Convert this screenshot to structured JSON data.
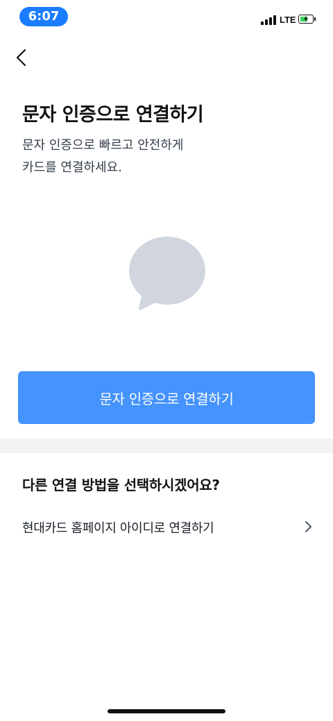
{
  "status_bar": {
    "time": "6:07",
    "network": "LTE"
  },
  "header": {
    "title": "문자 인증으로 연결하기",
    "description_lines": [
      "문자 인증으로 빠르고 안전하게",
      "카드를 연결하세요."
    ]
  },
  "illustration": {
    "icon": "chat-bubble-icon",
    "color": "#d1d6de"
  },
  "primary_action": {
    "label": "문자 인증으로 연결하기",
    "color": "#4593fc"
  },
  "alternatives": {
    "title": "다른 연결 방법을 선택하시겠어요?",
    "options": [
      {
        "label": "현대카드 홈페이지 아이디로 연결하기",
        "icon": "chevron-right-icon"
      }
    ]
  },
  "colors": {
    "time_pill": "#1a7cff",
    "battery_fill": "#2fd45a",
    "divider": "#f2f3f5"
  }
}
